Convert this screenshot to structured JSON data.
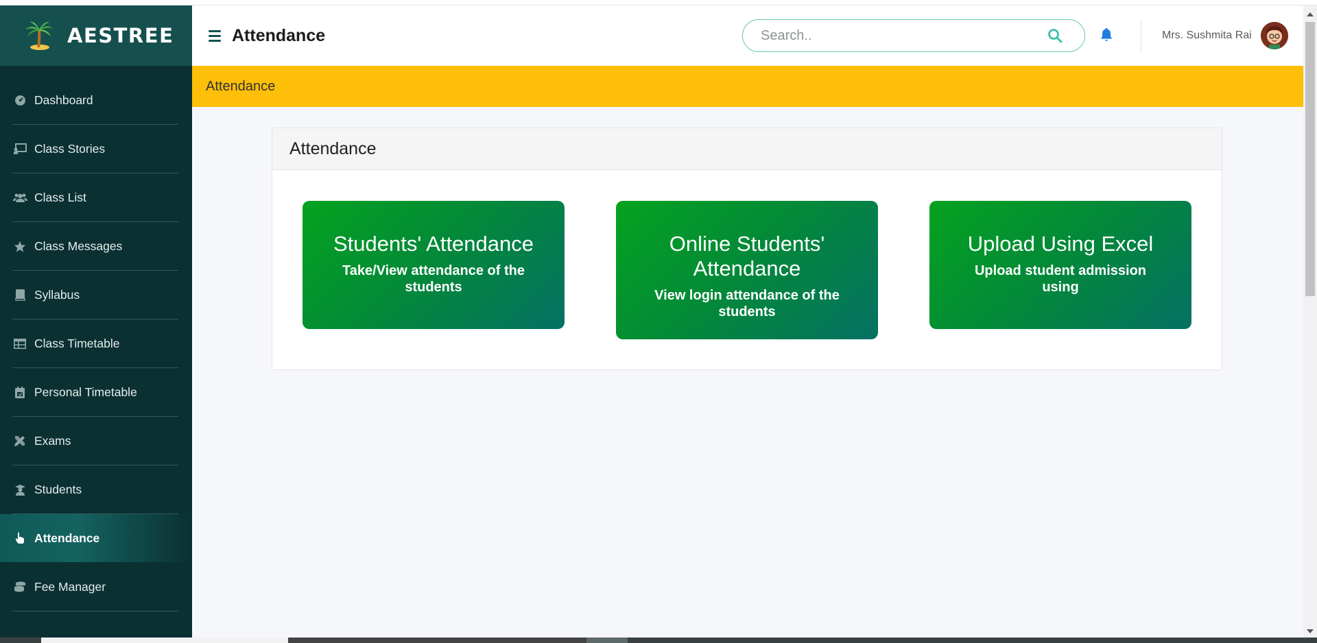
{
  "brand": {
    "name": "AESTREE"
  },
  "sidebar": {
    "items": [
      {
        "label": "Dashboard",
        "icon": "dashboard-icon"
      },
      {
        "label": "Class Stories",
        "icon": "chalkboard-icon"
      },
      {
        "label": "Class List",
        "icon": "users-icon"
      },
      {
        "label": "Class Messages",
        "icon": "star-icon"
      },
      {
        "label": "Syllabus",
        "icon": "book-icon"
      },
      {
        "label": "Class Timetable",
        "icon": "table-icon"
      },
      {
        "label": "Personal Timetable",
        "icon": "calendar-icon"
      },
      {
        "label": "Exams",
        "icon": "pencil-ruler-icon"
      },
      {
        "label": "Students",
        "icon": "graduate-icon"
      },
      {
        "label": "Attendance",
        "icon": "hand-pointer-icon",
        "active": true
      },
      {
        "label": "Fee Manager",
        "icon": "coins-icon"
      }
    ]
  },
  "header": {
    "title": "Attendance",
    "search_placeholder": "Search..",
    "user_name": "Mrs. Sushmita Rai"
  },
  "breadcrumb": {
    "label": "Attendance"
  },
  "card": {
    "title": "Attendance",
    "tiles": [
      {
        "title": "Students' Attendance",
        "subtitle": "Take/View attendance of the students"
      },
      {
        "title": "Online Students' Attendance",
        "subtitle": "View login attendance of the students"
      },
      {
        "title": "Upload Using Excel",
        "subtitle": "Upload student admission using"
      }
    ]
  },
  "colors": {
    "sidebar_bg": "#0b3032",
    "brand_bg": "#15504f",
    "breadcrumb_bar": "#fdbf07",
    "tile_gradient_start": "#05a21f",
    "tile_gradient_end": "#047163",
    "search_border": "#5fc7b3",
    "bell": "#1e7be3"
  }
}
